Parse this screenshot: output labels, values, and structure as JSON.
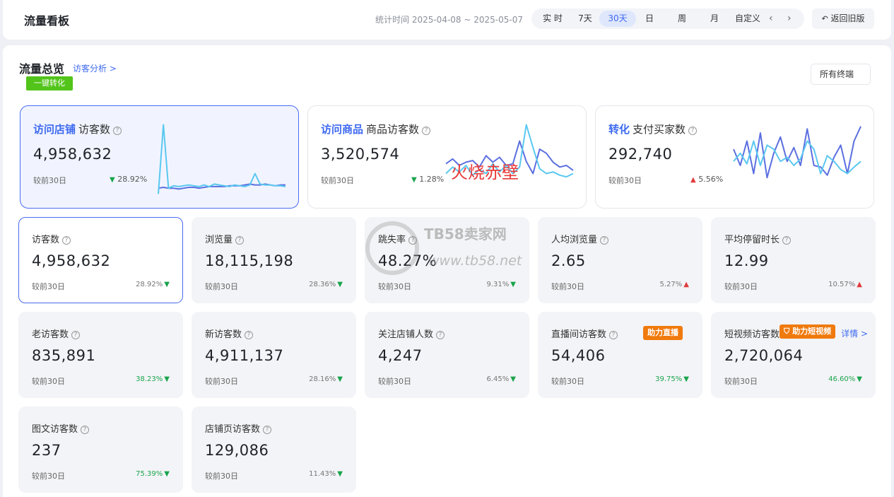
{
  "header": {
    "title": "流量看板",
    "stat_time": "统计时间 2025-04-08 ~ 2025-05-07",
    "ranges": [
      "实 时",
      "7天",
      "30天",
      "日",
      "周",
      "月",
      "自定义"
    ],
    "active_range": "30天",
    "back_button": "返回旧版"
  },
  "overview": {
    "title": "流量总览",
    "link": "访客分析 >",
    "convert_button": "一键转化",
    "terminal_select": "所有终端"
  },
  "big_cards": [
    {
      "highlight": "访问店铺",
      "label": "访客数",
      "value": "4,958,632",
      "compare": "较前30日",
      "pct": "28.92%",
      "trend": "down",
      "series_light": [
        95,
        10,
        88,
        85,
        86,
        85,
        84,
        85,
        86,
        84,
        86,
        83,
        84,
        85,
        86,
        84,
        85,
        86,
        84,
        70,
        83,
        84,
        84,
        85,
        85,
        86
      ],
      "series_dark": [
        88,
        87,
        88,
        88,
        89,
        88,
        87,
        87,
        88,
        87,
        86,
        86,
        86,
        86,
        85,
        85,
        85,
        84,
        83,
        84,
        84,
        83,
        84,
        85,
        84,
        84
      ]
    },
    {
      "highlight": "访问商品",
      "label": "商品访客数",
      "value": "3,520,574",
      "compare": "较前30日",
      "pct": "1.28%",
      "trend": "down",
      "series_light": [
        70,
        62,
        68,
        60,
        72,
        65,
        70,
        58,
        68,
        60,
        70,
        62,
        10,
        38,
        64,
        70,
        68,
        72,
        74,
        70
      ],
      "series_dark": [
        58,
        52,
        60,
        56,
        54,
        62,
        48,
        56,
        50,
        60,
        58,
        30,
        55,
        70,
        40,
        45,
        56,
        62,
        60,
        66
      ]
    },
    {
      "highlight": "转化",
      "label": "支付买家数",
      "value": "292,740",
      "compare": "较前30日",
      "pct": "5.56%",
      "trend": "up",
      "series_light": [
        55,
        45,
        58,
        30,
        60,
        35,
        40,
        55,
        50,
        60,
        52,
        30,
        40,
        70,
        48,
        55,
        65,
        70,
        62,
        55
      ],
      "series_dark": [
        40,
        60,
        30,
        70,
        20,
        75,
        45,
        25,
        55,
        38,
        60,
        15,
        60,
        62,
        72,
        50,
        35,
        70,
        30,
        12
      ]
    }
  ],
  "metrics": [
    {
      "name": "访客数",
      "value": "4,958,632",
      "compare": "较前30日",
      "pct": "28.92%",
      "trend": "down",
      "active": true
    },
    {
      "name": "浏览量",
      "value": "18,115,198",
      "compare": "较前30日",
      "pct": "28.36%",
      "trend": "down"
    },
    {
      "name": "跳失率",
      "value": "48.27%",
      "compare": "较前30日",
      "pct": "9.31%",
      "trend": "down"
    },
    {
      "name": "人均浏览量",
      "value": "2.65",
      "compare": "较前30日",
      "pct": "5.27%",
      "trend": "up"
    },
    {
      "name": "平均停留时长",
      "value": "12.99",
      "compare": "较前30日",
      "pct": "10.57%",
      "trend": "up"
    },
    {
      "name": "老访客数",
      "value": "835,891",
      "compare": "较前30日",
      "pct": "38.23%",
      "trend": "down",
      "green": true
    },
    {
      "name": "新访客数",
      "value": "4,911,137",
      "compare": "较前30日",
      "pct": "28.16%",
      "trend": "down"
    },
    {
      "name": "关注店铺人数",
      "value": "4,247",
      "compare": "较前30日",
      "pct": "6.45%",
      "trend": "down"
    },
    {
      "name": "直播间访客数",
      "value": "54,406",
      "compare": "较前30日",
      "pct": "39.75%",
      "trend": "down",
      "green": true,
      "badge": "助力直播"
    },
    {
      "name": "短视频访客数",
      "value": "2,720,064",
      "compare": "较前30日",
      "pct": "46.60%",
      "trend": "down",
      "green": true,
      "badge": "助力短视频",
      "detail": "详情 >"
    },
    {
      "name": "图文访客数",
      "value": "237",
      "compare": "较前30日",
      "pct": "75.39%",
      "trend": "down",
      "green": true
    },
    {
      "name": "店铺页访客数",
      "value": "129,086",
      "compare": "较前30日",
      "pct": "11.43%",
      "trend": "down"
    }
  ],
  "watermarks": {
    "red_text": "火烧赤壁",
    "site_name": "TB58卖家网",
    "site_url": "www.tb58.net"
  },
  "colors": {
    "accent": "#3e6af0",
    "green_button": "#52c41a",
    "badge_orange": "#f07a0d",
    "trend_down": "#19a44c",
    "trend_up": "#e03b3b",
    "line_light": "#5ac8f0",
    "line_dark": "#5b6fe0"
  }
}
